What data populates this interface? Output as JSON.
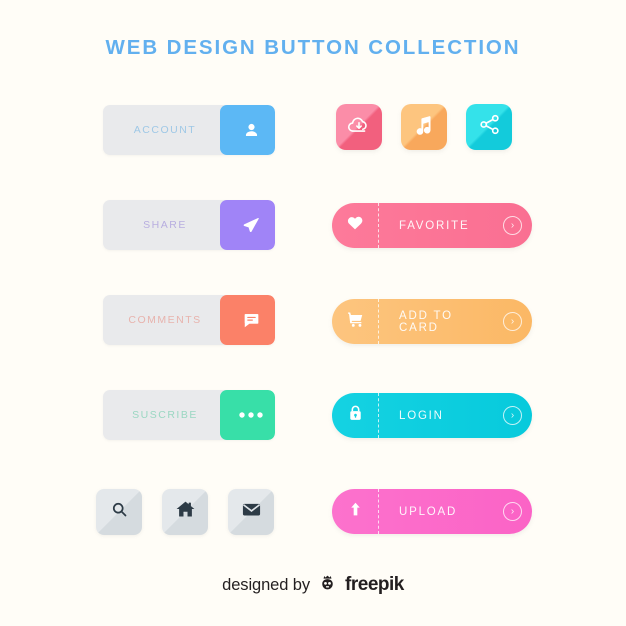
{
  "page": {
    "title": "WEB DESIGN BUTTON COLLECTION",
    "background_color": "#fffdf7",
    "title_color": "#62b0ef"
  },
  "split_buttons": [
    {
      "label": "ACCOUNT",
      "icon": "user-icon",
      "accent_color": "#5cb8f5",
      "label_color": "#9fc8e6",
      "panel_color": "#e9eaec"
    },
    {
      "label": "SHARE",
      "icon": "send-icon",
      "accent_color": "#a084f7",
      "label_color": "#b8aee0",
      "panel_color": "#e9eaec"
    },
    {
      "label": "COMMENTS",
      "icon": "comment-icon",
      "accent_color": "#fb8168",
      "label_color": "#e8b3ad",
      "panel_color": "#e9eaec"
    },
    {
      "label": "SUSCRIBE",
      "icon": "ellipsis-icon",
      "accent_color": "#38dfa8",
      "label_color": "#9ad7c2",
      "panel_color": "#e9eaec"
    }
  ],
  "icon_tiles": [
    {
      "icon": "cloud-download-icon",
      "color_start": "#fb8da8",
      "color_end": "#f4627f"
    },
    {
      "icon": "music-note-icon",
      "color_start": "#fdc27e",
      "color_end": "#f9a css"
    },
    {
      "icon": "share-nodes-icon",
      "color_start": "#2ee0e9",
      "color_end": "#14cfdd"
    }
  ],
  "icon_tile_colors": [
    {
      "name": "pink",
      "start": "#fb8da8",
      "end": "#f2607e"
    },
    {
      "name": "orange",
      "start": "#fdc57f",
      "end": "#f8a85c"
    },
    {
      "name": "cyan",
      "start": "#34e2ea",
      "end": "#13cbdb"
    }
  ],
  "pill_buttons": [
    {
      "label": "FAVORITE",
      "icon": "heart-icon",
      "arrow": "chevron-right-icon",
      "color_start": "#fd7a9a",
      "color_end": "#fa6f92"
    },
    {
      "label": "ADD TO CARD",
      "icon": "shopping-cart-icon",
      "arrow": "chevron-right-icon",
      "color_start": "#fdc57f",
      "color_end": "#fbb865"
    },
    {
      "label": "LOGIN",
      "icon": "lock-icon",
      "arrow": "chevron-right-icon",
      "color_start": "#15d2e2",
      "color_end": "#07cadc"
    },
    {
      "label": "UPLOAD",
      "icon": "upload-arrow-icon",
      "arrow": "chevron-right-icon",
      "color_start": "#fc72cd",
      "color_end": "#fb63c6"
    }
  ],
  "gray_tiles": [
    {
      "icon": "search-icon"
    },
    {
      "icon": "home-icon"
    },
    {
      "icon": "mail-icon"
    }
  ],
  "footer": {
    "designed_by": "designed by",
    "brand": "freepik",
    "logo": "freepik-robot-icon"
  },
  "arrow_glyph": "›"
}
